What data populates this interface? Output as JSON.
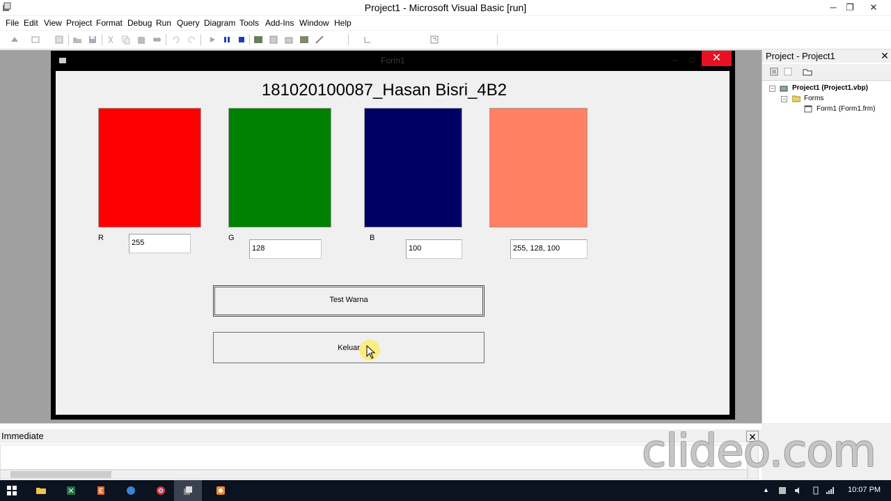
{
  "window": {
    "title": "Project1 - Microsoft Visual Basic [run]",
    "minimize": "─",
    "maximize": "❐",
    "close": "✕"
  },
  "menu": [
    "File",
    "Edit",
    "View",
    "Project",
    "Format",
    "Debug",
    "Run",
    "Query",
    "Diagram",
    "Tools",
    "Add-Ins",
    "Window",
    "Help"
  ],
  "form": {
    "caption": "Form1",
    "close": "✕",
    "heading": "181020100087_Hasan Bisri_4B2",
    "swatches": [
      {
        "name": "red",
        "color": "#ff0000"
      },
      {
        "name": "green",
        "color": "#008000"
      },
      {
        "name": "blue",
        "color": "#000064"
      },
      {
        "name": "mixed",
        "color": "#ff8064"
      }
    ],
    "labels": {
      "r": "R",
      "g": "G",
      "b": "B"
    },
    "inputs": {
      "r": "255",
      "g": "128",
      "b": "100",
      "rgb": "255, 128, 100"
    },
    "buttons": {
      "test": "Test Warna",
      "exit": "Keluar"
    }
  },
  "project_explorer": {
    "title": "Project - Project1",
    "close": "✕",
    "tree": {
      "project": "Project1 (Project1.vbp)",
      "folder": "Forms",
      "form": "Form1 (Form1.frm)"
    }
  },
  "immediate": {
    "title": "Immediate",
    "close": "✕",
    "content": ""
  },
  "watermark": "clideo.com",
  "taskbar": {
    "clock": "10:07 PM"
  },
  "colors": {
    "accent_close": "#e81123",
    "taskbar": "#0b1220",
    "mdi_background": "#a0a0a0"
  }
}
